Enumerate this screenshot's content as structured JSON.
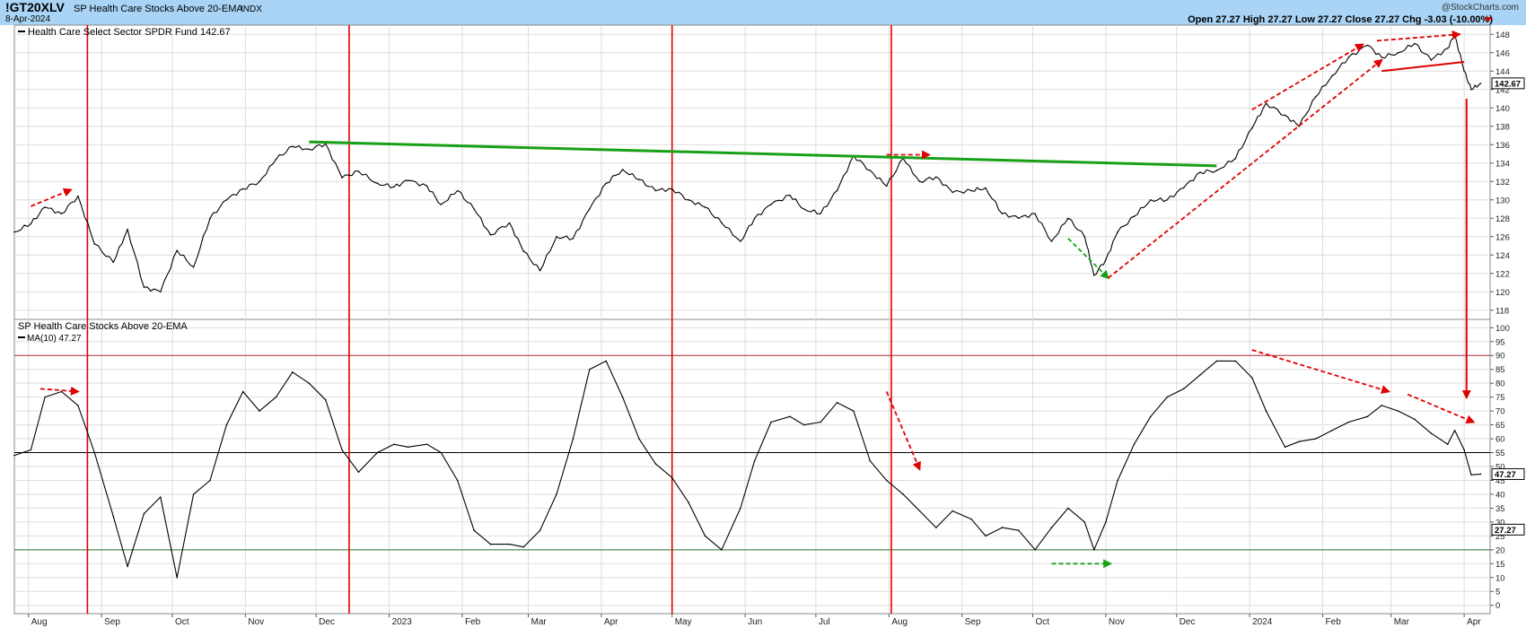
{
  "header": {
    "symbol": "!GT20XLV",
    "title": "SP Health Care Stocks Above 20-EMA",
    "index_tag": "INDX",
    "date": "8-Apr-2024",
    "watermark": "@StockCharts.com",
    "quote": "Open 27.27  High 27.27  Low 27.27  Close 27.27  Chg -3.03 (-10.00%)"
  },
  "colors": {
    "header_bg": "#a9d4f5",
    "price_line": "#000000",
    "red": "#e00000",
    "green": "#18a018",
    "grid": "#dddddd",
    "ref_90": "#b03040",
    "ref_20": "#2a7a2a"
  },
  "chart_data": [
    {
      "type": "line",
      "title": "Health Care Select Sector SPDR Fund 142.67",
      "ylim": [
        117,
        149
      ],
      "ytick_labels": [
        "118",
        "120",
        "122",
        "124",
        "126",
        "128",
        "130",
        "132",
        "134",
        "136",
        "138",
        "140",
        "142",
        "144",
        "146",
        "148"
      ],
      "last_value_label": "142.67",
      "series": [
        {
          "name": "Health Care Select Sector SPDR Fund",
          "x": [
            "2022-07-26",
            "2022-08-02",
            "2022-08-08",
            "2022-08-15",
            "2022-08-22",
            "2022-08-29",
            "2022-09-06",
            "2022-09-12",
            "2022-09-19",
            "2022-09-26",
            "2022-10-03",
            "2022-10-10",
            "2022-10-17",
            "2022-10-24",
            "2022-10-31",
            "2022-11-07",
            "2022-11-14",
            "2022-11-21",
            "2022-11-28",
            "2022-12-05",
            "2022-12-12",
            "2022-12-19",
            "2022-12-27",
            "2023-01-03",
            "2023-01-09",
            "2023-01-17",
            "2023-01-23",
            "2023-01-30",
            "2023-02-06",
            "2023-02-13",
            "2023-02-21",
            "2023-02-27",
            "2023-03-06",
            "2023-03-13",
            "2023-03-20",
            "2023-03-27",
            "2023-04-03",
            "2023-04-10",
            "2023-04-17",
            "2023-04-24",
            "2023-05-01",
            "2023-05-08",
            "2023-05-15",
            "2023-05-22",
            "2023-05-30",
            "2023-06-05",
            "2023-06-12",
            "2023-06-20",
            "2023-06-26",
            "2023-07-03",
            "2023-07-10",
            "2023-07-17",
            "2023-07-24",
            "2023-07-31",
            "2023-08-07",
            "2023-08-14",
            "2023-08-21",
            "2023-08-28",
            "2023-09-05",
            "2023-09-11",
            "2023-09-18",
            "2023-09-25",
            "2023-10-02",
            "2023-10-09",
            "2023-10-16",
            "2023-10-23",
            "2023-10-27",
            "2023-11-01",
            "2023-11-06",
            "2023-11-13",
            "2023-11-20",
            "2023-11-27",
            "2023-12-04",
            "2023-12-11",
            "2023-12-18",
            "2023-12-26",
            "2024-01-02",
            "2024-01-08",
            "2024-01-16",
            "2024-01-22",
            "2024-01-29",
            "2024-02-05",
            "2024-02-12",
            "2024-02-20",
            "2024-02-26",
            "2024-03-04",
            "2024-03-11",
            "2024-03-18",
            "2024-03-25",
            "2024-03-28",
            "2024-04-01",
            "2024-04-04",
            "2024-04-08"
          ],
          "values": [
            126.5,
            127.4,
            129.2,
            128.5,
            130.4,
            125.2,
            123.2,
            126.8,
            120.5,
            120.0,
            124.5,
            122.7,
            128.0,
            130.0,
            131.2,
            132.0,
            134.4,
            135.8,
            135.5,
            136.1,
            132.4,
            133.1,
            131.8,
            131.4,
            132.1,
            131.5,
            129.5,
            131.0,
            129.0,
            126.2,
            127.5,
            124.4,
            122.3,
            126.0,
            125.8,
            129.0,
            131.8,
            133.3,
            132.2,
            131.0,
            131.2,
            130.0,
            129.2,
            127.5,
            125.5,
            128.0,
            129.5,
            130.5,
            129.0,
            128.5,
            131.0,
            134.8,
            133.2,
            131.5,
            134.5,
            132.0,
            132.5,
            130.8,
            131.0,
            131.3,
            128.5,
            128.0,
            128.5,
            125.5,
            128.0,
            126.0,
            121.8,
            123.5,
            126.5,
            128.2,
            130.0,
            130.0,
            131.3,
            133.0,
            133.2,
            134.5,
            137.8,
            140.5,
            139.2,
            138.0,
            141.2,
            143.5,
            145.5,
            146.8,
            145.5,
            146.0,
            147.0,
            145.2,
            146.5,
            148.0,
            144.0,
            142.0,
            142.67
          ]
        }
      ],
      "annotations": [
        {
          "type": "trendline",
          "color": "green",
          "from": [
            "2022-11-28",
            136.3
          ],
          "to": [
            "2023-12-18",
            133.7
          ]
        },
        {
          "type": "trendline",
          "color": "red",
          "from": [
            "2024-02-26",
            144.0
          ],
          "to": [
            "2024-04-01",
            145.0
          ]
        },
        {
          "type": "dashed-arrow",
          "color": "red",
          "from": [
            "2022-08-02",
            129.3
          ],
          "to": [
            "2022-08-19",
            131.1
          ]
        },
        {
          "type": "dashed-arrow",
          "color": "red",
          "from": [
            "2023-07-31",
            134.9
          ],
          "to": [
            "2023-08-18",
            134.9
          ]
        },
        {
          "type": "dashed-arrow",
          "color": "green",
          "from": [
            "2023-10-16",
            125.8
          ],
          "to": [
            "2023-11-02",
            121.5
          ]
        },
        {
          "type": "dashed-arrow",
          "color": "red",
          "from": [
            "2023-11-02",
            121.5
          ],
          "to": [
            "2024-02-26",
            145.2
          ]
        },
        {
          "type": "dashed-arrow",
          "color": "red",
          "from": [
            "2024-01-02",
            139.8
          ],
          "to": [
            "2024-02-18",
            146.9
          ]
        },
        {
          "type": "dashed-arrow",
          "color": "red",
          "from": [
            "2024-02-24",
            147.3
          ],
          "to": [
            "2024-03-30",
            148.0
          ]
        },
        {
          "type": "arrow",
          "color": "red",
          "from": [
            "2024-04-02",
            141.0
          ],
          "to": [
            "2024-04-02",
            108.5
          ]
        }
      ]
    },
    {
      "type": "line",
      "title": "SP Health Care Stocks Above 20-EMA",
      "legend": "MA(10) 47.27",
      "ylim": [
        0,
        100
      ],
      "ytick_labels": [
        "0",
        "5",
        "10",
        "15",
        "20",
        "25",
        "30",
        "35",
        "40",
        "45",
        "50",
        "55",
        "60",
        "65",
        "70",
        "75",
        "80",
        "85",
        "90",
        "95",
        "100"
      ],
      "reference_lines": [
        90,
        55,
        20
      ],
      "value_labels": [
        "47.27",
        "27.27"
      ],
      "series": [
        {
          "name": "MA(10)",
          "x": [
            "2022-07-26",
            "2022-08-02",
            "2022-08-08",
            "2022-08-15",
            "2022-08-22",
            "2022-08-29",
            "2022-09-06",
            "2022-09-12",
            "2022-09-19",
            "2022-09-26",
            "2022-10-03",
            "2022-10-10",
            "2022-10-17",
            "2022-10-24",
            "2022-10-31",
            "2022-11-07",
            "2022-11-14",
            "2022-11-21",
            "2022-11-28",
            "2022-12-05",
            "2022-12-12",
            "2022-12-19",
            "2022-12-27",
            "2023-01-03",
            "2023-01-09",
            "2023-01-17",
            "2023-01-23",
            "2023-01-30",
            "2023-02-06",
            "2023-02-13",
            "2023-02-21",
            "2023-02-27",
            "2023-03-06",
            "2023-03-13",
            "2023-03-20",
            "2023-03-27",
            "2023-04-03",
            "2023-04-10",
            "2023-04-17",
            "2023-04-24",
            "2023-05-01",
            "2023-05-08",
            "2023-05-15",
            "2023-05-22",
            "2023-05-30",
            "2023-06-05",
            "2023-06-12",
            "2023-06-20",
            "2023-06-26",
            "2023-07-03",
            "2023-07-10",
            "2023-07-17",
            "2023-07-24",
            "2023-07-31",
            "2023-08-07",
            "2023-08-14",
            "2023-08-21",
            "2023-08-28",
            "2023-09-05",
            "2023-09-11",
            "2023-09-18",
            "2023-09-25",
            "2023-10-02",
            "2023-10-09",
            "2023-10-16",
            "2023-10-23",
            "2023-10-27",
            "2023-11-01",
            "2023-11-06",
            "2023-11-13",
            "2023-11-20",
            "2023-11-27",
            "2023-12-04",
            "2023-12-11",
            "2023-12-18",
            "2023-12-26",
            "2024-01-02",
            "2024-01-08",
            "2024-01-16",
            "2024-01-22",
            "2024-01-29",
            "2024-02-05",
            "2024-02-12",
            "2024-02-20",
            "2024-02-26",
            "2024-03-04",
            "2024-03-11",
            "2024-03-18",
            "2024-03-25",
            "2024-03-28",
            "2024-04-01",
            "2024-04-04",
            "2024-04-08"
          ],
          "values": [
            54,
            56,
            75,
            77,
            72,
            55,
            32,
            14,
            33,
            39,
            10,
            40,
            45,
            65,
            77,
            70,
            75,
            84,
            80,
            74,
            56,
            48,
            55,
            58,
            57,
            58,
            55,
            45,
            27,
            22,
            22,
            21,
            27,
            40,
            60,
            85,
            88,
            75,
            60,
            51,
            46,
            37,
            25,
            20,
            35,
            52,
            66,
            68,
            65,
            66,
            73,
            70,
            52,
            45,
            40,
            34,
            28,
            34,
            31,
            25,
            28,
            27,
            20,
            28,
            35,
            30,
            20,
            30,
            45,
            58,
            68,
            75,
            78,
            83,
            88,
            88,
            82,
            70,
            57,
            59,
            60,
            63,
            66,
            68,
            72,
            70,
            67,
            62,
            58,
            63,
            56,
            47,
            47.27
          ]
        }
      ],
      "annotations": [
        {
          "type": "dashed-arrow",
          "color": "red",
          "from": [
            "2022-08-06",
            78
          ],
          "to": [
            "2022-08-22",
            77
          ]
        },
        {
          "type": "dashed-arrow",
          "color": "red",
          "from": [
            "2023-07-31",
            77
          ],
          "to": [
            "2023-08-14",
            49
          ]
        },
        {
          "type": "dashed-arrow",
          "color": "green",
          "from": [
            "2023-10-09",
            15
          ],
          "to": [
            "2023-11-03",
            15
          ]
        },
        {
          "type": "dashed-arrow",
          "color": "red",
          "from": [
            "2024-01-02",
            92
          ],
          "to": [
            "2024-02-29",
            77
          ]
        },
        {
          "type": "dashed-arrow",
          "color": "red",
          "from": [
            "2024-03-08",
            76
          ],
          "to": [
            "2024-04-05",
            66
          ]
        }
      ]
    }
  ],
  "vertical_markers": [
    "2022-08-26",
    "2022-12-15",
    "2023-05-01",
    "2023-08-02"
  ],
  "x_axis": {
    "labels": [
      {
        "text": "Aug",
        "date": "2022-08-01"
      },
      {
        "text": "Sep",
        "date": "2022-09-01"
      },
      {
        "text": "Oct",
        "date": "2022-10-01"
      },
      {
        "text": "Nov",
        "date": "2022-11-01"
      },
      {
        "text": "Dec",
        "date": "2022-12-01"
      },
      {
        "text": "2023",
        "date": "2023-01-01"
      },
      {
        "text": "Feb",
        "date": "2023-02-01"
      },
      {
        "text": "Mar",
        "date": "2023-03-01"
      },
      {
        "text": "Apr",
        "date": "2023-04-01"
      },
      {
        "text": "May",
        "date": "2023-05-01"
      },
      {
        "text": "Jun",
        "date": "2023-06-01"
      },
      {
        "text": "Jul",
        "date": "2023-07-01"
      },
      {
        "text": "Aug",
        "date": "2023-08-01"
      },
      {
        "text": "Sep",
        "date": "2023-09-01"
      },
      {
        "text": "Oct",
        "date": "2023-10-01"
      },
      {
        "text": "Nov",
        "date": "2023-11-01"
      },
      {
        "text": "Dec",
        "date": "2023-12-01"
      },
      {
        "text": "2024",
        "date": "2024-01-01"
      },
      {
        "text": "Feb",
        "date": "2024-02-01"
      },
      {
        "text": "Mar",
        "date": "2024-03-01"
      },
      {
        "text": "Apr",
        "date": "2024-04-01"
      }
    ]
  }
}
